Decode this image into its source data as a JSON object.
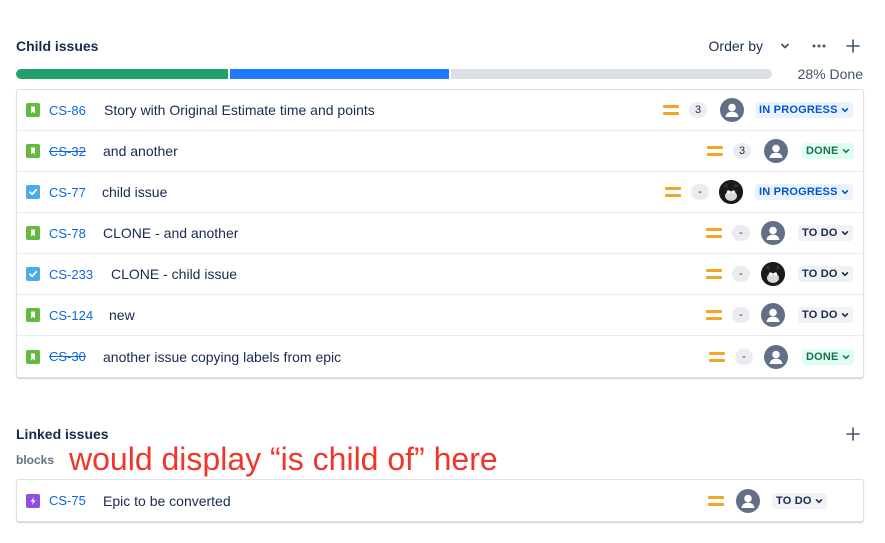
{
  "child_issues": {
    "title": "Child issues",
    "order_by_label": "Order by",
    "progress_label": "28% Done",
    "progress": {
      "done_fraction": 0.28,
      "in_progress_fraction": 0.29,
      "todo_fraction": 0.43
    },
    "rows": [
      {
        "key": "CS-86",
        "summary": "Story with Original Estimate time and points",
        "type": "story",
        "priority": "medium",
        "points": "3",
        "avatar": "default",
        "status": "IN PROGRESS",
        "status_kind": "inprogress",
        "resolved": false
      },
      {
        "key": "CS-32",
        "summary": "and another",
        "type": "story",
        "priority": "medium",
        "points": "3",
        "avatar": "default",
        "status": "DONE",
        "status_kind": "done",
        "resolved": true
      },
      {
        "key": "CS-77",
        "summary": "child issue",
        "type": "task",
        "priority": "medium",
        "points": "-",
        "avatar": "photo",
        "status": "IN PROGRESS",
        "status_kind": "inprogress",
        "resolved": false
      },
      {
        "key": "CS-78",
        "summary": "CLONE - and another",
        "type": "story",
        "priority": "medium",
        "points": "-",
        "avatar": "default",
        "status": "TO DO",
        "status_kind": "todo",
        "resolved": false
      },
      {
        "key": "CS-233",
        "summary": "CLONE - child issue",
        "type": "task",
        "priority": "medium",
        "points": "-",
        "avatar": "photo",
        "status": "TO DO",
        "status_kind": "todo",
        "resolved": false
      },
      {
        "key": "CS-124",
        "summary": "new",
        "type": "story",
        "priority": "medium",
        "points": "-",
        "avatar": "default",
        "status": "TO DO",
        "status_kind": "todo",
        "resolved": false
      },
      {
        "key": "CS-30",
        "summary": "another issue copying labels from epic",
        "type": "story",
        "priority": "medium",
        "points": "-",
        "avatar": "default",
        "status": "DONE",
        "status_kind": "done",
        "resolved": true
      }
    ]
  },
  "linked_issues": {
    "title": "Linked issues",
    "relation_label": "blocks",
    "annotation": "would display “is child of” here",
    "rows": [
      {
        "key": "CS-75",
        "summary": "Epic to be converted",
        "type": "epic",
        "priority": "medium",
        "avatar": "default",
        "status": "TO DO",
        "status_kind": "todo",
        "resolved": false
      }
    ]
  },
  "icons": {
    "order_by": "chevron-down-icon",
    "more": "more-icon",
    "add": "plus-icon",
    "story": "story-icon",
    "task": "task-icon",
    "epic": "epic-icon",
    "priority": "priority-medium-icon",
    "avatar_default": "user-icon"
  },
  "colors": {
    "story": "#63ba3c",
    "task": "#4bade8",
    "epic": "#904ee2",
    "priority_medium": "#f5a524",
    "link": "#0c66e4",
    "annotation": "#f0352a",
    "progress_done": "#22a06b",
    "progress_in_progress": "#1d7afc",
    "progress_todo": "#dcdfe4"
  }
}
